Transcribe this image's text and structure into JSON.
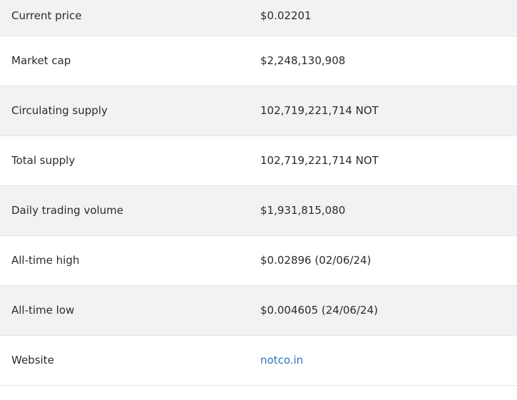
{
  "stats": [
    {
      "label": "Current price",
      "value": "$0.02201"
    },
    {
      "label": "Market cap",
      "value": "$2,248,130,908"
    },
    {
      "label": "Circulating supply",
      "value": "102,719,221,714 NOT"
    },
    {
      "label": "Total supply",
      "value": "102,719,221,714 NOT"
    },
    {
      "label": "Daily trading volume",
      "value": "$1,931,815,080"
    },
    {
      "label": "All-time high",
      "value": "$0.02896 (02/06/24)"
    },
    {
      "label": "All-time low",
      "value": "$0.004605 (24/06/24)"
    },
    {
      "label": "Website",
      "value": "notco.in"
    }
  ],
  "colors": {
    "row_alt": "#f1f2f4",
    "link": "#2e73c2",
    "divider": "#e3e6e9"
  }
}
